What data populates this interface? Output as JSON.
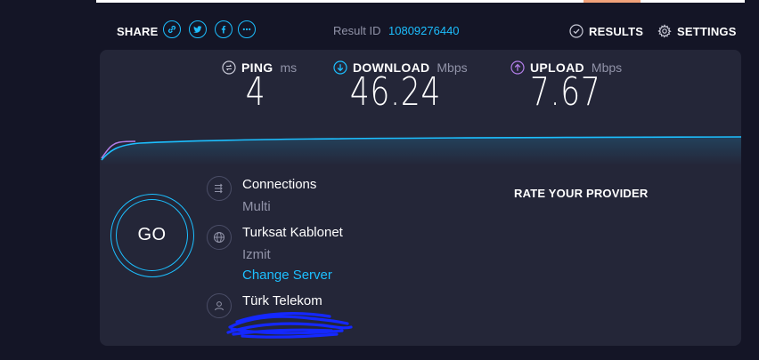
{
  "topbar": {
    "share_label": "SHARE",
    "share_icons": [
      "link-icon",
      "twitter-icon",
      "facebook-icon",
      "more-icon"
    ],
    "result_label": "Result ID",
    "result_id": "10809276440",
    "results_label": "RESULTS",
    "settings_label": "SETTINGS"
  },
  "metrics": {
    "ping": {
      "name": "PING",
      "unit": "ms",
      "value": "4"
    },
    "download": {
      "name": "DOWNLOAD",
      "unit": "Mbps",
      "value": "46.24"
    },
    "upload": {
      "name": "UPLOAD",
      "unit": "Mbps",
      "value": "7.67"
    }
  },
  "go_label": "GO",
  "connections": {
    "title": "Connections",
    "value": "Multi"
  },
  "server": {
    "name": "Turksat Kablonet",
    "location": "Izmit",
    "change_label": "Change Server"
  },
  "provider": {
    "name": "Türk Telekom"
  },
  "rate_label": "RATE YOUR PROVIDER",
  "colors": {
    "accent": "#1cbfff",
    "upload": "#b27ee8",
    "background": "#141526",
    "card": "#242638",
    "muted": "#9193a8",
    "scribble": "#1428ff"
  }
}
